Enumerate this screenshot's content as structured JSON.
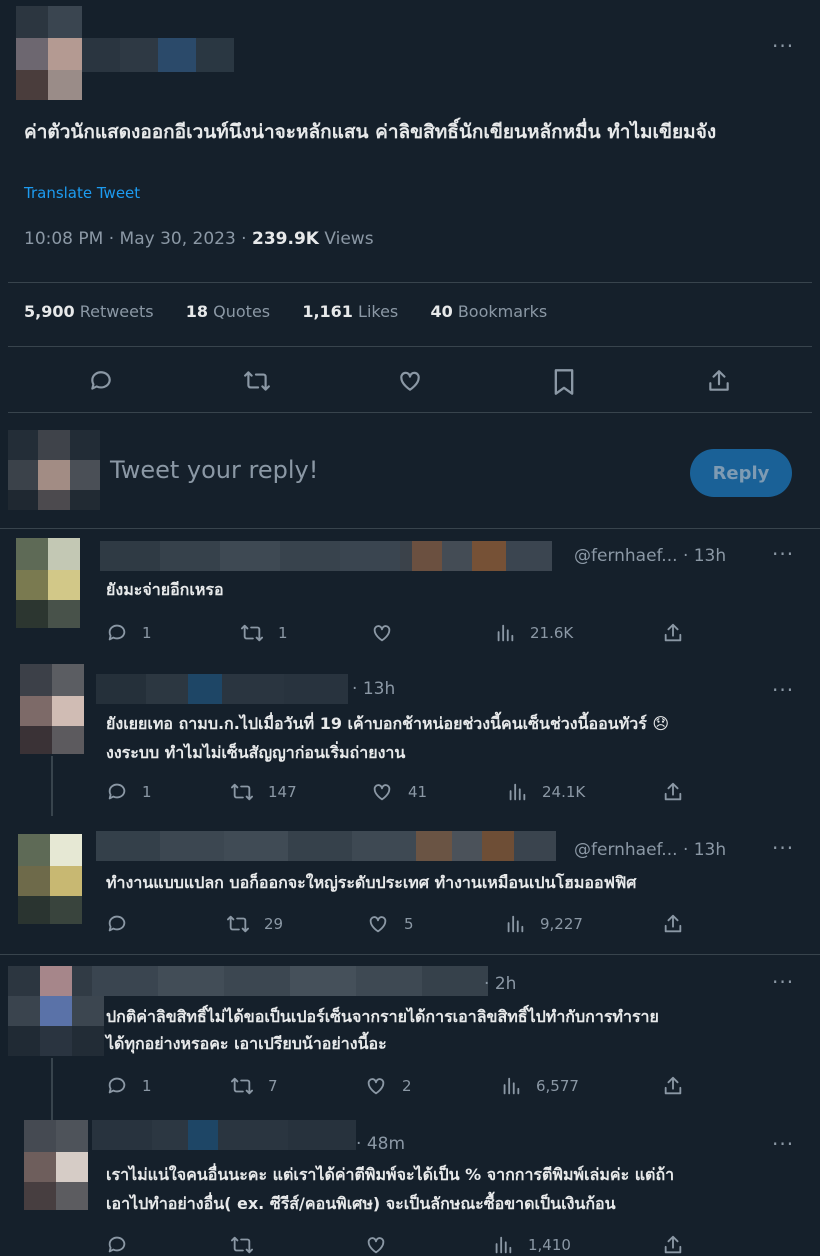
{
  "tweet": {
    "text": "ค่าตัวนักแสดงออกอีเวนท์นึงน่าจะหลักแสน ค่าลิขสิทธิ์นักเขียนหลักหมื่น ทำไมเขียมจัง",
    "translate_label": "Translate Tweet",
    "time": "10:08 PM · May 30, 2023 · ",
    "views_count": "239.9K",
    "views_label": " Views",
    "stats": {
      "retweets_count": "5,900",
      "retweets_label": "Retweets",
      "quotes_count": "18",
      "quotes_label": "Quotes",
      "likes_count": "1,161",
      "likes_label": "Likes",
      "bookmarks_count": "40",
      "bookmarks_label": "Bookmarks"
    },
    "more": "···"
  },
  "composer": {
    "placeholder": "Tweet your reply!",
    "reply_button": "Reply"
  },
  "replies": [
    {
      "handle": "@fernhaef...",
      "time": "· 13h",
      "text": "ยังมะจ่ายอีกเหรอ",
      "retweets": "1",
      "likes": "",
      "views": "21.6K",
      "replies_count": "1"
    },
    {
      "handle": "",
      "time": "13h",
      "text_line1": "ยังเยยเทอ ถามบ.ก.ไปเมื่อวันที่ 19 เค้าบอกช้าหน่อยช่วงนี้คนเซ็นช่วงนี้ออนทัวร์ 😞",
      "text_line2": "งงระบบ ทำไมไม่เซ็นสัญญาก่อนเริ่มถ่ายงาน",
      "replies_count": "1",
      "retweets": "147",
      "likes": "41",
      "views": "24.1K"
    },
    {
      "handle": "@fernhaef...",
      "time": "· 13h",
      "text": "ทำงานแบบแปลก บอก็ออกจะใหญ่ระดับประเทศ ทำงานเหมือนเปนโฮมออฟฟิศ",
      "retweets": "29",
      "likes": "5",
      "views": "9,227"
    },
    {
      "handle": "",
      "time": "2h",
      "text_line1": "ปกติค่าลิขสิทธิ์ไม่ได้ขอเป็นเปอร์เซ็นจากรายได้การเอาลิขสิทธิ์ไปทำกับการทำราย",
      "text_line2": "ได้ทุกอย่างหรอคะ เอาเปรียบน้าอย่างนี้อะ",
      "replies_count": "1",
      "retweets": "7",
      "likes": "2",
      "views": "6,577"
    },
    {
      "handle": "",
      "time": "48m",
      "text_line1": "เราไม่แน่ใจคนอื่นนะคะ แต่เราได้ค่าตีพิมพ์จะได้เป็น % จากการตีพิมพ์เล่มค่ะ แต่ถ้า",
      "text_line2": "เอาไปทำอย่างอื่น( ex. ซีรีส์/คอนพิเศษ) จะเป็นลักษณะซื้อขาดเป็นเงินก้อน",
      "views": "1,410"
    }
  ],
  "colors": {
    "background": "#15202b",
    "text": "#e7e9ea",
    "muted": "#8b98a5",
    "accent": "#1d9bf0",
    "divider": "#38444d"
  },
  "icons": [
    "reply-icon",
    "retweet-icon",
    "like-icon",
    "bookmark-icon",
    "share-icon",
    "views-icon",
    "more-icon"
  ]
}
